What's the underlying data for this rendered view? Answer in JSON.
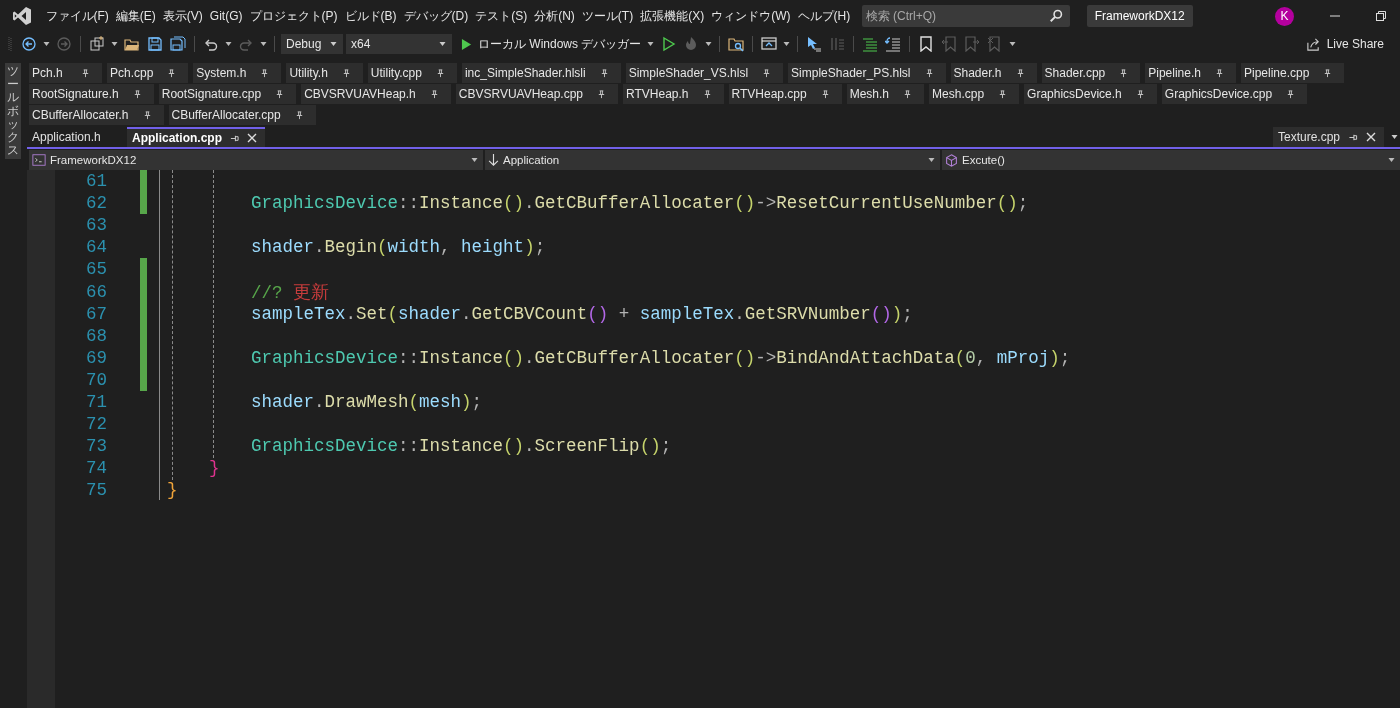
{
  "menu_bar": {
    "items": [
      "ファイル(F)",
      "編集(E)",
      "表示(V)",
      "Git(G)",
      "プロジェクト(P)",
      "ビルド(B)",
      "デバッグ(D)",
      "テスト(S)",
      "分析(N)",
      "ツール(T)",
      "拡張機能(X)",
      "ウィンドウ(W)",
      "ヘルプ(H)"
    ],
    "search": {
      "placeholder": "検索 (Ctrl+Q)"
    },
    "solution_name": "FrameworkDX12",
    "avatar": "K"
  },
  "toolbar": {
    "items": [
      {
        "kind": "back",
        "disabled": false
      },
      {
        "kind": "caret"
      },
      {
        "kind": "forward",
        "disabled": true
      },
      {
        "kind": "separator"
      },
      {
        "kind": "newitem",
        "disabled": false
      },
      {
        "kind": "caret"
      },
      {
        "kind": "open",
        "disabled": false
      },
      {
        "kind": "save",
        "disabled": false
      },
      {
        "kind": "saveall",
        "disabled": false
      },
      {
        "kind": "separator"
      },
      {
        "kind": "undo",
        "disabled": false
      },
      {
        "kind": "caret"
      },
      {
        "kind": "redo",
        "disabled": true
      },
      {
        "kind": "caret"
      },
      {
        "kind": "separator"
      },
      {
        "kind": "combo",
        "text": "Debug",
        "wide": false
      },
      {
        "kind": "combo",
        "text": "x64",
        "wide": true
      },
      {
        "kind": "start",
        "text": "ローカル Windows デバッガー"
      },
      {
        "kind": "caret"
      },
      {
        "kind": "startplain",
        "disabled": false
      },
      {
        "kind": "hotreload",
        "disabled": true
      },
      {
        "kind": "caret"
      },
      {
        "kind": "separator"
      },
      {
        "kind": "browse",
        "disabled": false
      },
      {
        "kind": "separator"
      },
      {
        "kind": "window",
        "disabled": false
      },
      {
        "kind": "caret"
      },
      {
        "kind": "separator"
      },
      {
        "kind": "pointer",
        "disabled": false
      },
      {
        "kind": "columns",
        "disabled": true
      },
      {
        "kind": "separator"
      },
      {
        "kind": "comment",
        "disabled": false
      },
      {
        "kind": "uncomment",
        "disabled": false
      },
      {
        "kind": "separator"
      },
      {
        "kind": "bookmark",
        "disabled": false
      },
      {
        "kind": "bookmarkprev",
        "disabled": true
      },
      {
        "kind": "bookmarknext",
        "disabled": true
      },
      {
        "kind": "bookmarkclear",
        "disabled": true
      },
      {
        "kind": "caret"
      }
    ],
    "live_share": "Live Share"
  },
  "toolbox_label": "ツールボックス",
  "pinned_tab_rows": [
    [
      {
        "label": "Pch.h"
      },
      {
        "label": "Pch.cpp"
      },
      {
        "label": "System.h"
      },
      {
        "label": "Utility.h"
      },
      {
        "label": "Utility.cpp"
      },
      {
        "label": "inc_SimpleShader.hlsli"
      },
      {
        "label": "SimpleShader_VS.hlsl"
      },
      {
        "label": "SimpleShader_PS.hlsl"
      },
      {
        "label": "Shader.h"
      },
      {
        "label": "Shader.cpp"
      },
      {
        "label": "Pipeline.h"
      },
      {
        "label": "Pipeline.cpp"
      }
    ],
    [
      {
        "label": "RootSignature.h"
      },
      {
        "label": "RootSignature.cpp"
      },
      {
        "label": "CBVSRVUAVHeap.h"
      },
      {
        "label": "CBVSRVUAVHeap.cpp"
      },
      {
        "label": "RTVHeap.h"
      },
      {
        "label": "RTVHeap.cpp"
      },
      {
        "label": "Mesh.h"
      },
      {
        "label": "Mesh.cpp"
      },
      {
        "label": "GraphicsDevice.h"
      },
      {
        "label": "GraphicsDevice.cpp"
      }
    ],
    [
      {
        "label": "CBufferAllocater.h"
      },
      {
        "label": "CBufferAllocater.cpp"
      }
    ]
  ],
  "tabs": [
    {
      "label": "Application.h",
      "selected": false,
      "pinned": false,
      "closable": false
    },
    {
      "label": "Application.cpp",
      "selected": true,
      "pinned": true,
      "closable": true
    }
  ],
  "right_tabs": [
    {
      "label": "Texture.cpp",
      "selected": false,
      "pinned": true,
      "closable": true
    }
  ],
  "navigation_bar": [
    {
      "kind": "project",
      "text": "FrameworkDX12"
    },
    {
      "kind": "scope",
      "text": "Application"
    },
    {
      "kind": "method",
      "text": "Excute()"
    }
  ],
  "code_lines": [
    {
      "number": "61",
      "modified": true
    },
    {
      "number": "62",
      "modified": true,
      "tokens": [
        {
          "kind": "class",
          "text": "        GraphicsDevice"
        },
        {
          "kind": "punct",
          "text": "::"
        },
        {
          "kind": "func",
          "text": "Instance"
        },
        {
          "kind": "paren1",
          "text": "()"
        },
        {
          "kind": "punct",
          "text": "."
        },
        {
          "kind": "func",
          "text": "GetCBufferAllocater"
        },
        {
          "kind": "paren1",
          "text": "()"
        },
        {
          "kind": "punct",
          "text": "->"
        },
        {
          "kind": "func",
          "text": "ResetCurrentUseNumber"
        },
        {
          "kind": "paren1",
          "text": "()"
        },
        {
          "kind": "punct",
          "text": ";"
        }
      ]
    },
    {
      "number": "63",
      "modified": false
    },
    {
      "number": "64",
      "modified": false,
      "tokens": [
        {
          "kind": "var",
          "text": "        shader"
        },
        {
          "kind": "punct",
          "text": "."
        },
        {
          "kind": "func",
          "text": "Begin"
        },
        {
          "kind": "paren1",
          "text": "("
        },
        {
          "kind": "var",
          "text": "width"
        },
        {
          "kind": "punct",
          "text": ", "
        },
        {
          "kind": "var",
          "text": "height"
        },
        {
          "kind": "paren1",
          "text": ")"
        },
        {
          "kind": "punct",
          "text": ";"
        }
      ]
    },
    {
      "number": "65",
      "modified": true
    },
    {
      "number": "66",
      "modified": true,
      "tokens": [
        {
          "kind": "comment",
          "text": "        //? "
        },
        {
          "kind": "todo",
          "text": "更新"
        }
      ]
    },
    {
      "number": "67",
      "modified": true,
      "tokens": [
        {
          "kind": "var",
          "text": "        sampleTex"
        },
        {
          "kind": "punct",
          "text": "."
        },
        {
          "kind": "func",
          "text": "Set"
        },
        {
          "kind": "paren1",
          "text": "("
        },
        {
          "kind": "var",
          "text": "shader"
        },
        {
          "kind": "punct",
          "text": "."
        },
        {
          "kind": "func",
          "text": "GetCBVCount"
        },
        {
          "kind": "paren2",
          "text": "()"
        },
        {
          "kind": "punct",
          "text": " + "
        },
        {
          "kind": "var",
          "text": "sampleTex"
        },
        {
          "kind": "punct",
          "text": "."
        },
        {
          "kind": "func",
          "text": "GetSRVNumber"
        },
        {
          "kind": "paren2",
          "text": "()"
        },
        {
          "kind": "paren1",
          "text": ")"
        },
        {
          "kind": "punct",
          "text": ";"
        }
      ]
    },
    {
      "number": "68",
      "modified": true
    },
    {
      "number": "69",
      "modified": true,
      "tokens": [
        {
          "kind": "class",
          "text": "        GraphicsDevice"
        },
        {
          "kind": "punct",
          "text": "::"
        },
        {
          "kind": "func",
          "text": "Instance"
        },
        {
          "kind": "paren1",
          "text": "()"
        },
        {
          "kind": "punct",
          "text": "."
        },
        {
          "kind": "func",
          "text": "GetCBufferAllocater"
        },
        {
          "kind": "paren1",
          "text": "()"
        },
        {
          "kind": "punct",
          "text": "->"
        },
        {
          "kind": "func",
          "text": "BindAndAttachData"
        },
        {
          "kind": "paren1",
          "text": "("
        },
        {
          "kind": "number",
          "text": "0"
        },
        {
          "kind": "punct",
          "text": ", "
        },
        {
          "kind": "var",
          "text": "mProj"
        },
        {
          "kind": "paren1",
          "text": ")"
        },
        {
          "kind": "punct",
          "text": ";"
        }
      ]
    },
    {
      "number": "70",
      "modified": true
    },
    {
      "number": "71",
      "modified": false,
      "tokens": [
        {
          "kind": "var",
          "text": "        shader"
        },
        {
          "kind": "punct",
          "text": "."
        },
        {
          "kind": "func",
          "text": "DrawMesh"
        },
        {
          "kind": "paren1",
          "text": "("
        },
        {
          "kind": "var",
          "text": "mesh"
        },
        {
          "kind": "paren1",
          "text": ")"
        },
        {
          "kind": "punct",
          "text": ";"
        }
      ]
    },
    {
      "number": "72",
      "modified": false
    },
    {
      "number": "73",
      "modified": false,
      "tokens": [
        {
          "kind": "class",
          "text": "        GraphicsDevice"
        },
        {
          "kind": "punct",
          "text": "::"
        },
        {
          "kind": "func",
          "text": "Instance"
        },
        {
          "kind": "paren1",
          "text": "()"
        },
        {
          "kind": "punct",
          "text": "."
        },
        {
          "kind": "func",
          "text": "ScreenFlip"
        },
        {
          "kind": "paren1",
          "text": "()"
        },
        {
          "kind": "punct",
          "text": ";"
        }
      ]
    },
    {
      "number": "74",
      "modified": false,
      "tokens": [
        {
          "kind": "brace1",
          "text": "    }"
        }
      ]
    },
    {
      "number": "75",
      "modified": false,
      "tokens": [
        {
          "kind": "brace0",
          "text": "}"
        }
      ]
    }
  ]
}
